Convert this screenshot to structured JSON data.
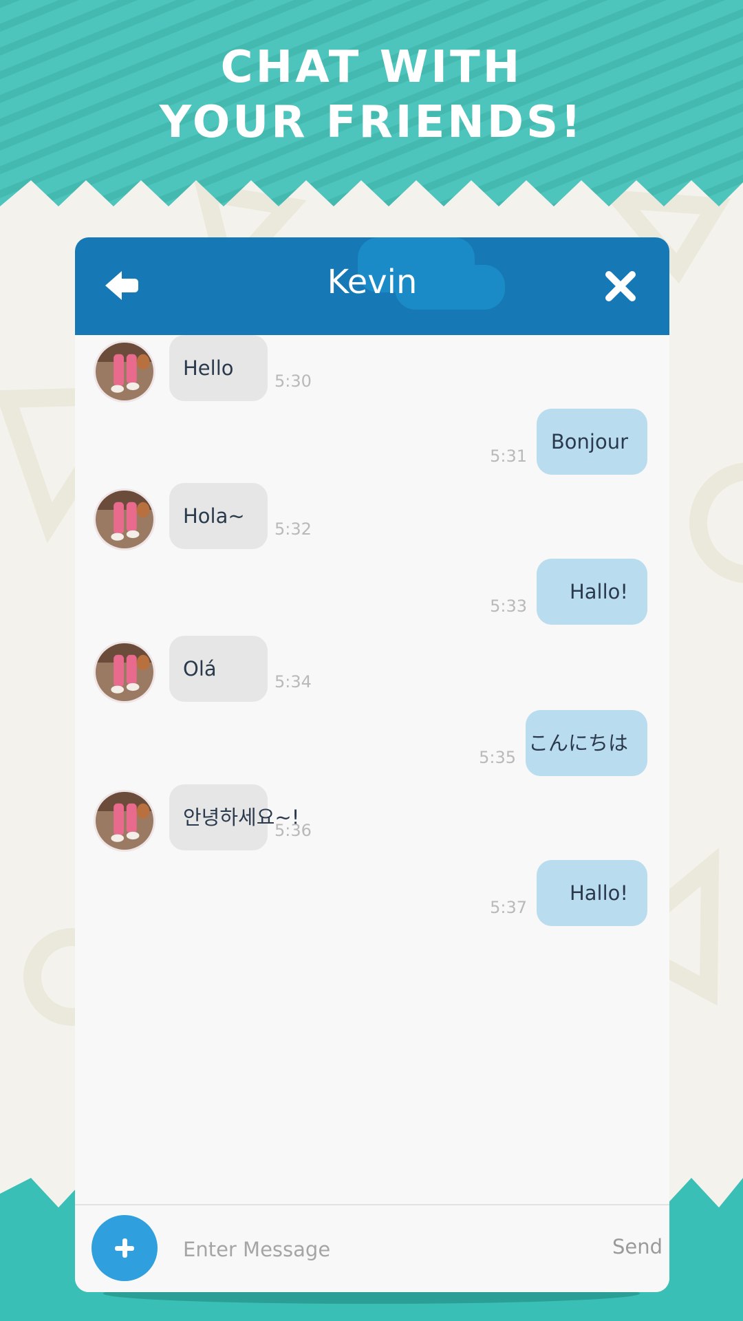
{
  "headline": {
    "line1": "Chat with",
    "line2": "your friends!"
  },
  "colors": {
    "teal": "#4ec5bc",
    "header_blue": "#1679b5",
    "incoming_bubble": "#e6e6e6",
    "outgoing_bubble": "#badcef",
    "add_button": "#2f9fdd"
  },
  "chat": {
    "contact_name": "Kevin",
    "back_icon": "arrow-left-icon",
    "close_icon": "close-icon",
    "messages": [
      {
        "direction": "in",
        "text": "Hello",
        "time": "5:30"
      },
      {
        "direction": "out",
        "text": "Bonjour",
        "time": "5:31"
      },
      {
        "direction": "in",
        "text": "Hola~",
        "time": "5:32"
      },
      {
        "direction": "out",
        "text": "Hallo!",
        "time": "5:33"
      },
      {
        "direction": "in",
        "text": "Olá",
        "time": "5:34"
      },
      {
        "direction": "out",
        "text": "こんにちは",
        "time": "5:35"
      },
      {
        "direction": "in",
        "text": "안녕하세요~!",
        "time": "5:36"
      },
      {
        "direction": "out",
        "text": "Hallo!",
        "time": "5:37"
      }
    ]
  },
  "composer": {
    "add_icon": "plus-icon",
    "placeholder": "Enter Message",
    "send_label": "Send"
  }
}
